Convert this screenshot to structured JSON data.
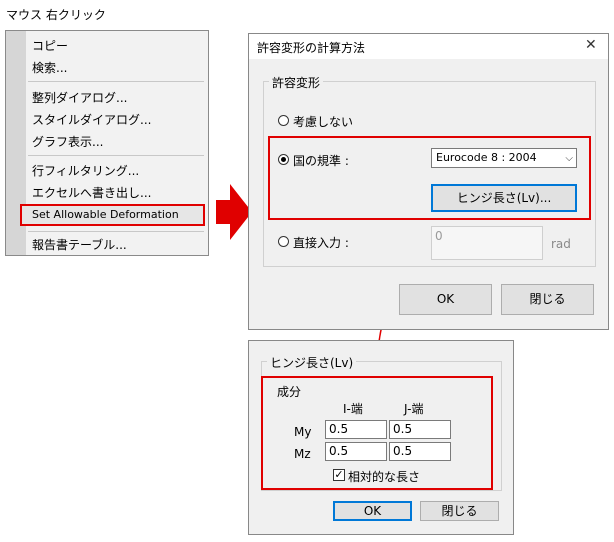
{
  "caption": "マウス 右クリック",
  "context_menu": {
    "items": [
      "コピー",
      "検索...",
      "整列ダイアログ...",
      "スタイルダイアログ...",
      "グラフ表示...",
      "行フィルタリング...",
      "エクセルへ書き出し...",
      "Set Allowable Deformation",
      "報告書テーブル..."
    ]
  },
  "dialog1": {
    "title": "許容変形の計算方法",
    "close_glyph": "✕",
    "group_label": "許容変形",
    "opt_none": "考慮しない",
    "opt_code": "国の規準 :",
    "code_select": "Eurocode 8 : 2004",
    "hinge_button": "ヒンジ長さ(Lv)...",
    "opt_direct": "直接入力 :",
    "direct_value": "0",
    "direct_unit": "rad",
    "ok": "OK",
    "close": "閉じる"
  },
  "dialog2": {
    "group_label": "ヒンジ長さ(Lv)",
    "section": "成分",
    "col_i": "I-端",
    "col_j": "J-端",
    "row_my": "My",
    "row_mz": "Mz",
    "my_i": "0.5",
    "my_j": "0.5",
    "mz_i": "0.5",
    "mz_j": "0.5",
    "relative_label": "相対的な長さ",
    "relative_checked": "✓",
    "ok": "OK",
    "close": "閉じる"
  },
  "colors": {
    "highlight_red": "#e00000",
    "dialog_bg": "#f0f0f0",
    "focus_blue": "#0078d7"
  }
}
